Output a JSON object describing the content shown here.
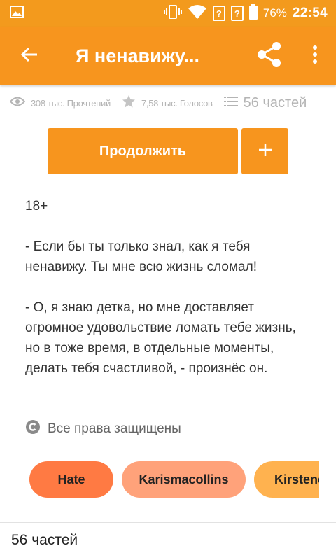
{
  "status_bar": {
    "battery_percent": "76%",
    "time": "22:54",
    "sim1": "?",
    "sim2": "?",
    "icons": [
      "image-icon",
      "vibrate-icon",
      "wifi-icon",
      "sim-icon",
      "battery-icon"
    ]
  },
  "app_bar": {
    "title": "Я ненавижу...",
    "back_icon": "arrow-left-icon",
    "share_icon": "share-icon",
    "more_icon": "more-vertical-icon"
  },
  "stats": {
    "reads": "308 тыс. Прочтений",
    "votes": "7,58 тыс. Голосов",
    "parts": "56 частей"
  },
  "actions": {
    "continue_label": "Продолжить",
    "add_label": "+"
  },
  "description": {
    "line1": "18+",
    "line2": "- Если бы ты только знал, как я тебя ненавижу. Ты мне всю жизнь сломал!",
    "line3": "- О, я знаю детка, но мне доставляет огромное удовольствие ломать тебе жизнь, но в тоже время, в отдельные моменты, делать тебя счастливой, - произнёс он."
  },
  "copyright": {
    "text": "Все права защищены"
  },
  "tags": [
    {
      "label": "Hate"
    },
    {
      "label": "Karismacollins"
    },
    {
      "label": "Kirstenc"
    }
  ],
  "footer": {
    "parts_label": "56 частей"
  },
  "colors": {
    "accent": "#f7951e",
    "tag1": "#ff7a43",
    "tag2": "#ffa27a",
    "tag3": "#ffb24f"
  }
}
